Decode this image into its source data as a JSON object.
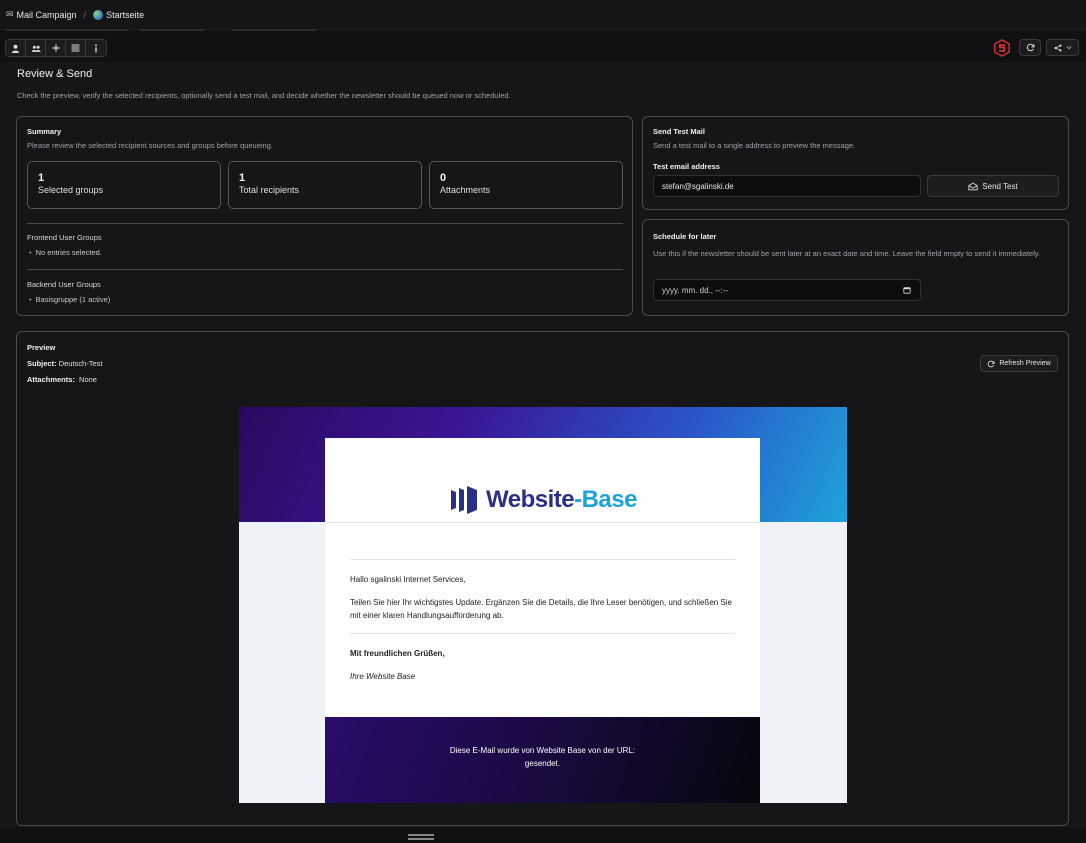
{
  "breadcrumb": {
    "module": "Mail Campaign",
    "separator": "/",
    "page": "Startseite"
  },
  "icons": {
    "toolbar": [
      "user-icon",
      "users-icon",
      "plus-icon",
      "list-icon",
      "info-icon"
    ],
    "refresh": "refresh-icon",
    "share": "share-icon",
    "chevron": "chevron-down-icon",
    "send": "send-icon",
    "calendar": "calendar-icon"
  },
  "colors": {
    "accent_red": "#d63031",
    "brand_blue": "#2b2f86",
    "brand_cyan": "#1ea3db"
  },
  "header": {
    "title": "Review & Send",
    "description": "Check the preview, verify the selected recipients, optionally send a test mail, and decide whether the newsletter should be queued now or scheduled."
  },
  "summary": {
    "title": "Summary",
    "subtitle": "Please review the selected recipient sources and groups before queueing.",
    "stats": [
      {
        "value": "1",
        "label": "Selected groups"
      },
      {
        "value": "1",
        "label": "Total recipients"
      },
      {
        "value": "0",
        "label": "Attachments"
      }
    ],
    "frontend": {
      "label": "Frontend User Groups",
      "items": [
        "No entries selected."
      ]
    },
    "backend": {
      "label": "Backend User Groups",
      "items": [
        "Basisgruppe (1 active)"
      ]
    }
  },
  "test_mail": {
    "title": "Send Test Mail",
    "subtitle": "Send a test mail to a single address to preview the message.",
    "field_label": "Test email address",
    "value": "stefan@sgalinski.de",
    "button": "Send Test"
  },
  "schedule": {
    "title": "Schedule for later",
    "subtitle": "Use this if the newsletter should be sent later at an exact date and time. Leave the field empty to send it immediately.",
    "placeholder": "yyyy. mm. dd., --:--"
  },
  "preview": {
    "title": "Preview",
    "subject_label": "Subject:",
    "subject_value": "Deutsch-Test",
    "attachments_label": "Attachments:",
    "attachments_value": "None",
    "refresh_button": "Refresh Preview"
  },
  "email": {
    "logo_part1": "Website",
    "logo_sep": "-",
    "logo_part2": "Base",
    "greeting": "Hallo sgalinski Internet Services,",
    "body": "Teilen Sie hier Ihr wichtigstes Update. Ergänzen Sie die Details, die Ihre Leser benötigen, und schließen Sie mit einer klaren Handlungsaufforderung ab.",
    "closing": "Mit freundlichen Grüßen,",
    "signature": "Ihre Website Base",
    "footer_line1": "Diese E-Mail wurde von Website Base von der URL:",
    "footer_line2": "gesendet."
  }
}
